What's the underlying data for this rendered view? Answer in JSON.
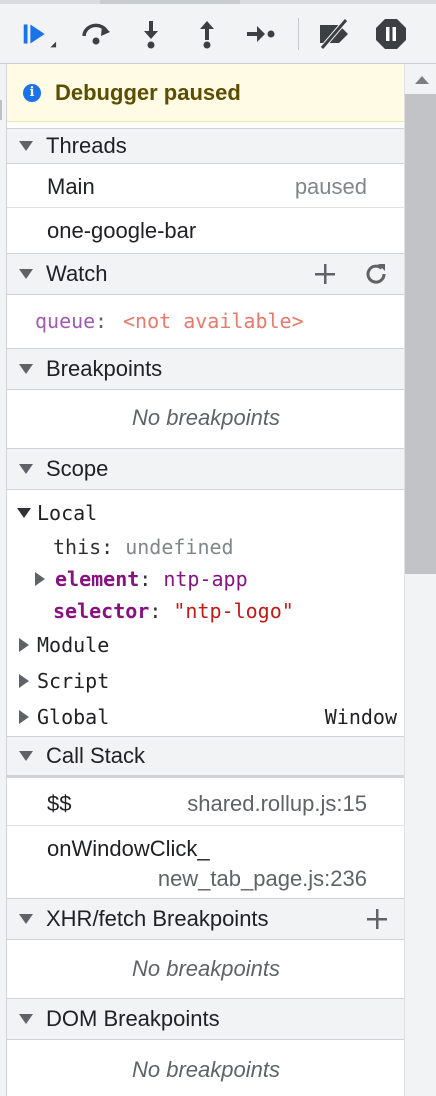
{
  "banner": {
    "text": "Debugger paused"
  },
  "threads": {
    "title": "Threads",
    "items": [
      {
        "name": "Main",
        "status": "paused"
      },
      {
        "name": "one-google-bar",
        "status": ""
      }
    ]
  },
  "watch": {
    "title": "Watch",
    "expr_name": "queue",
    "expr_sep": ":",
    "expr_value": "<not available>"
  },
  "breakpoints": {
    "title": "Breakpoints",
    "empty": "No breakpoints"
  },
  "scope": {
    "title": "Scope",
    "local_label": "Local",
    "this_name": "this",
    "this_value": "undefined",
    "element_name": "element",
    "element_value": "ntp-app",
    "selector_name": "selector",
    "selector_value": "\"ntp-logo\"",
    "colon": ":",
    "module_label": "Module",
    "script_label": "Script",
    "global_label": "Global",
    "global_value": "Window"
  },
  "callstack": {
    "title": "Call Stack",
    "frames": [
      {
        "fn": "$$",
        "loc": "shared.rollup.js:15"
      },
      {
        "fn": "onWindowClick_",
        "loc": "new_tab_page.js:236"
      }
    ]
  },
  "xhr": {
    "title": "XHR/fetch Breakpoints",
    "empty": "No breakpoints"
  },
  "dom": {
    "title": "DOM Breakpoints",
    "empty": "No breakpoints"
  },
  "colors": {
    "accent": "#1a73e8",
    "watch_name": "#a05bb0",
    "watch_value": "#e8796b",
    "prop_name": "#881280",
    "string_value": "#c41a16"
  }
}
